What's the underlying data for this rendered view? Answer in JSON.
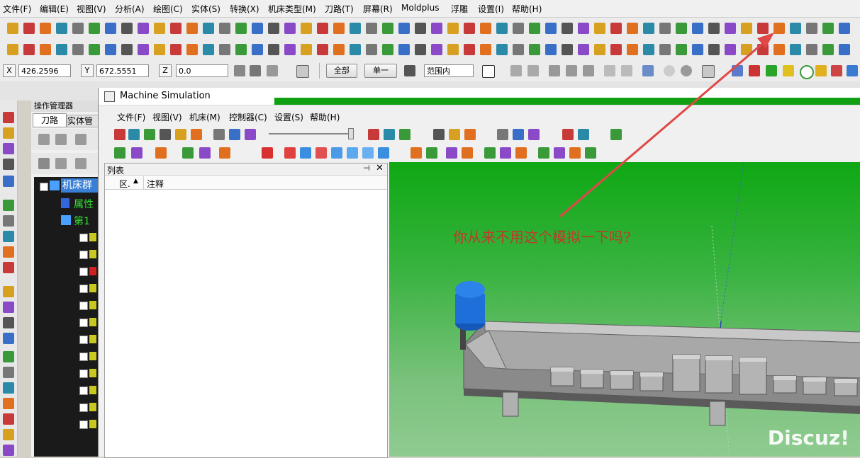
{
  "menu": [
    "文件(F)",
    "编辑(E)",
    "视图(V)",
    "分析(A)",
    "绘图(C)",
    "实体(S)",
    "转换(X)",
    "机床类型(M)",
    "刀路(T)",
    "屏幕(R)",
    "Moldplus",
    "浮雕",
    "设置(I)",
    "帮助(H)"
  ],
  "coords": {
    "x_label": "X",
    "x_value": "426.2596",
    "y_label": "Y",
    "y_value": "672.5551",
    "z_label": "Z",
    "z_value": "0.0"
  },
  "select_bar": {
    "all": "全部",
    "single": "单一",
    "range": "范围内"
  },
  "op_manager": {
    "title": "操作管理器",
    "tab1": "刀路",
    "tab2": "实体管",
    "tree_root": "机床群",
    "tree_prop": "属性",
    "tree_group": "第1"
  },
  "sim": {
    "title": "Machine Simulation",
    "menu": [
      "文件(F)",
      "视图(V)",
      "机床(M)",
      "控制器(C)",
      "设置(S)",
      "帮助(H)"
    ],
    "list_title": "列表",
    "col1": "区.",
    "col2": "注释",
    "annotation": "你从来不用这个模拟一下吗?"
  },
  "watermark": "Discuz!",
  "colors": {
    "annotation": "#c0392b",
    "arrow": "#e04848",
    "viewport_top": "#0fa814",
    "tool_blue": "#1e6fd9"
  }
}
